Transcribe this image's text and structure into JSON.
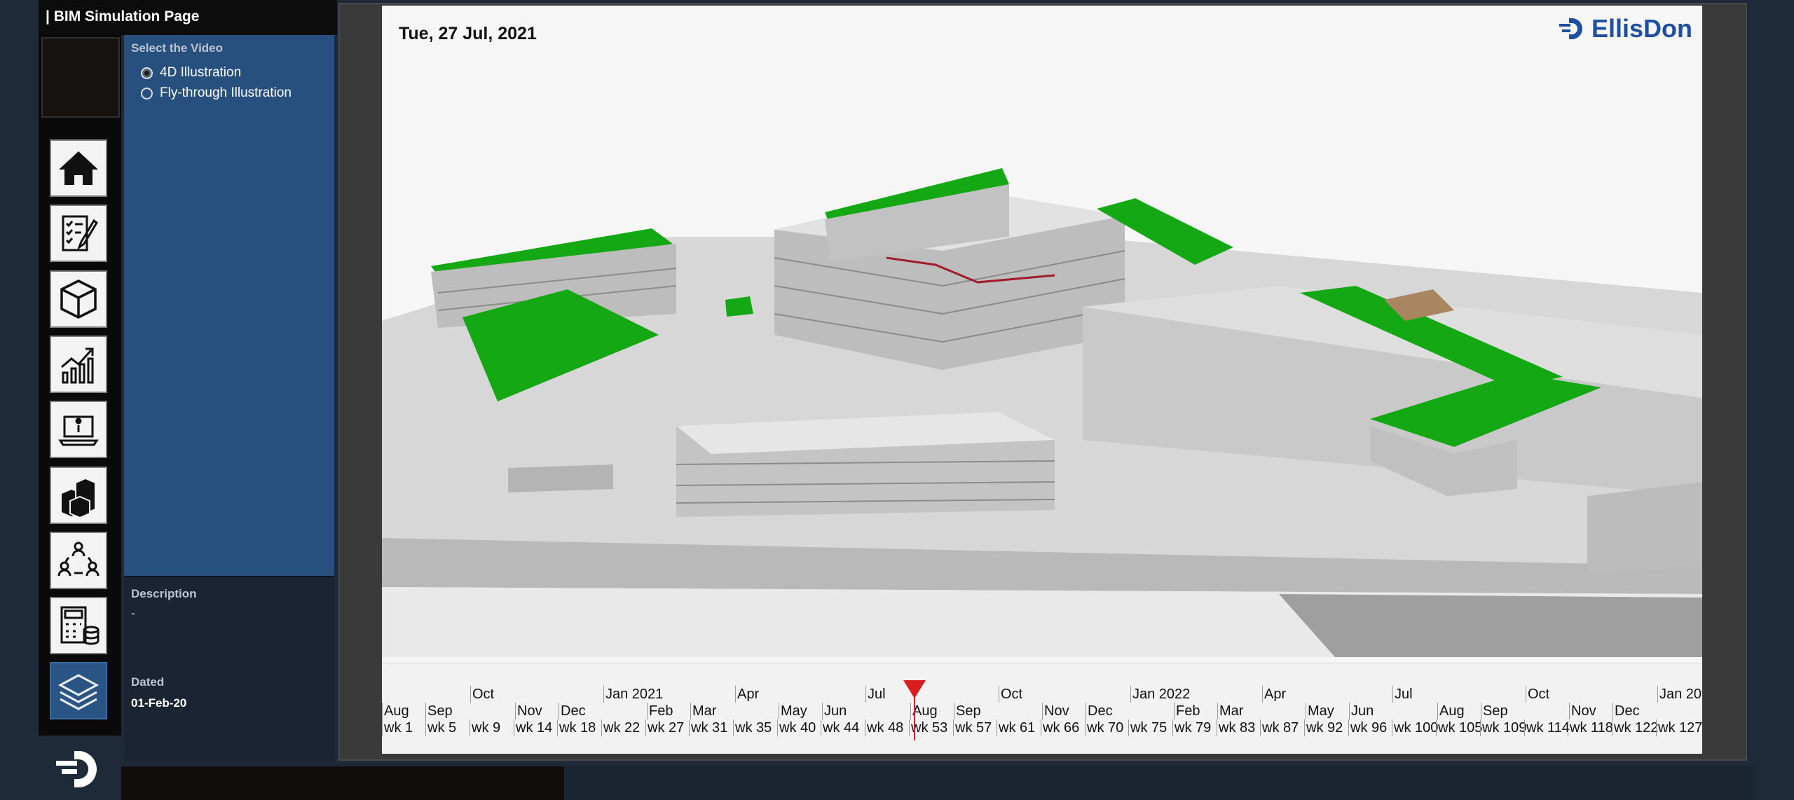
{
  "page": {
    "title": "| BIM Simulation Page"
  },
  "nav": {
    "items": [
      {
        "icon": "home-icon",
        "active": false
      },
      {
        "icon": "checklist-icon",
        "active": false
      },
      {
        "icon": "cube-icon",
        "active": false
      },
      {
        "icon": "growth-chart-icon",
        "active": false
      },
      {
        "icon": "info-laptop-icon",
        "active": false
      },
      {
        "icon": "blocks-icon",
        "active": false
      },
      {
        "icon": "team-cycle-icon",
        "active": false
      },
      {
        "icon": "calculator-database-icon",
        "active": false
      },
      {
        "icon": "layers-icon",
        "active": true
      }
    ]
  },
  "video_selector": {
    "label": "Select the Video",
    "options": [
      {
        "label": "4D Illustration",
        "selected": true
      },
      {
        "label": "Fly-through Illustration",
        "selected": false
      }
    ]
  },
  "description": {
    "label": "Description",
    "value": "-"
  },
  "dated": {
    "label": "Dated",
    "value": "01-Feb-20"
  },
  "video": {
    "date": "Tue, 27 Jul, 2021",
    "brand": "EllisDon",
    "colors": {
      "roof": "#14a814",
      "concrete": "#c8c8c8",
      "brand": "#1f4fa0",
      "marker": "#d81e1e"
    }
  },
  "timeline": {
    "quarters": [
      "Oct",
      "Jan 2021",
      "Apr",
      "Jul",
      "Oct",
      "Jan 2022",
      "Apr",
      "Jul",
      "Oct",
      "Jan 20"
    ],
    "months": [
      "Aug",
      "Sep",
      "Nov",
      "Dec",
      "Feb",
      "Mar",
      "May",
      "Jun",
      "Aug",
      "Sep",
      "Nov",
      "Dec",
      "Feb",
      "Mar",
      "May",
      "Jun",
      "Aug",
      "Sep",
      "Nov",
      "Dec"
    ],
    "weeks": [
      "wk 1",
      "wk 5",
      "wk 9",
      "wk 14",
      "wk 18",
      "wk 22",
      "wk 27",
      "wk 31",
      "wk 35",
      "wk 40",
      "wk 44",
      "wk 48",
      "wk 53",
      "wk 57",
      "wk 61",
      "wk 66",
      "wk 70",
      "wk 75",
      "wk 79",
      "wk 83",
      "wk 87",
      "wk 92",
      "wk 96",
      "wk 100",
      "wk 105",
      "wk 109",
      "wk 114",
      "wk 118",
      "wk 122",
      "wk 127"
    ]
  }
}
